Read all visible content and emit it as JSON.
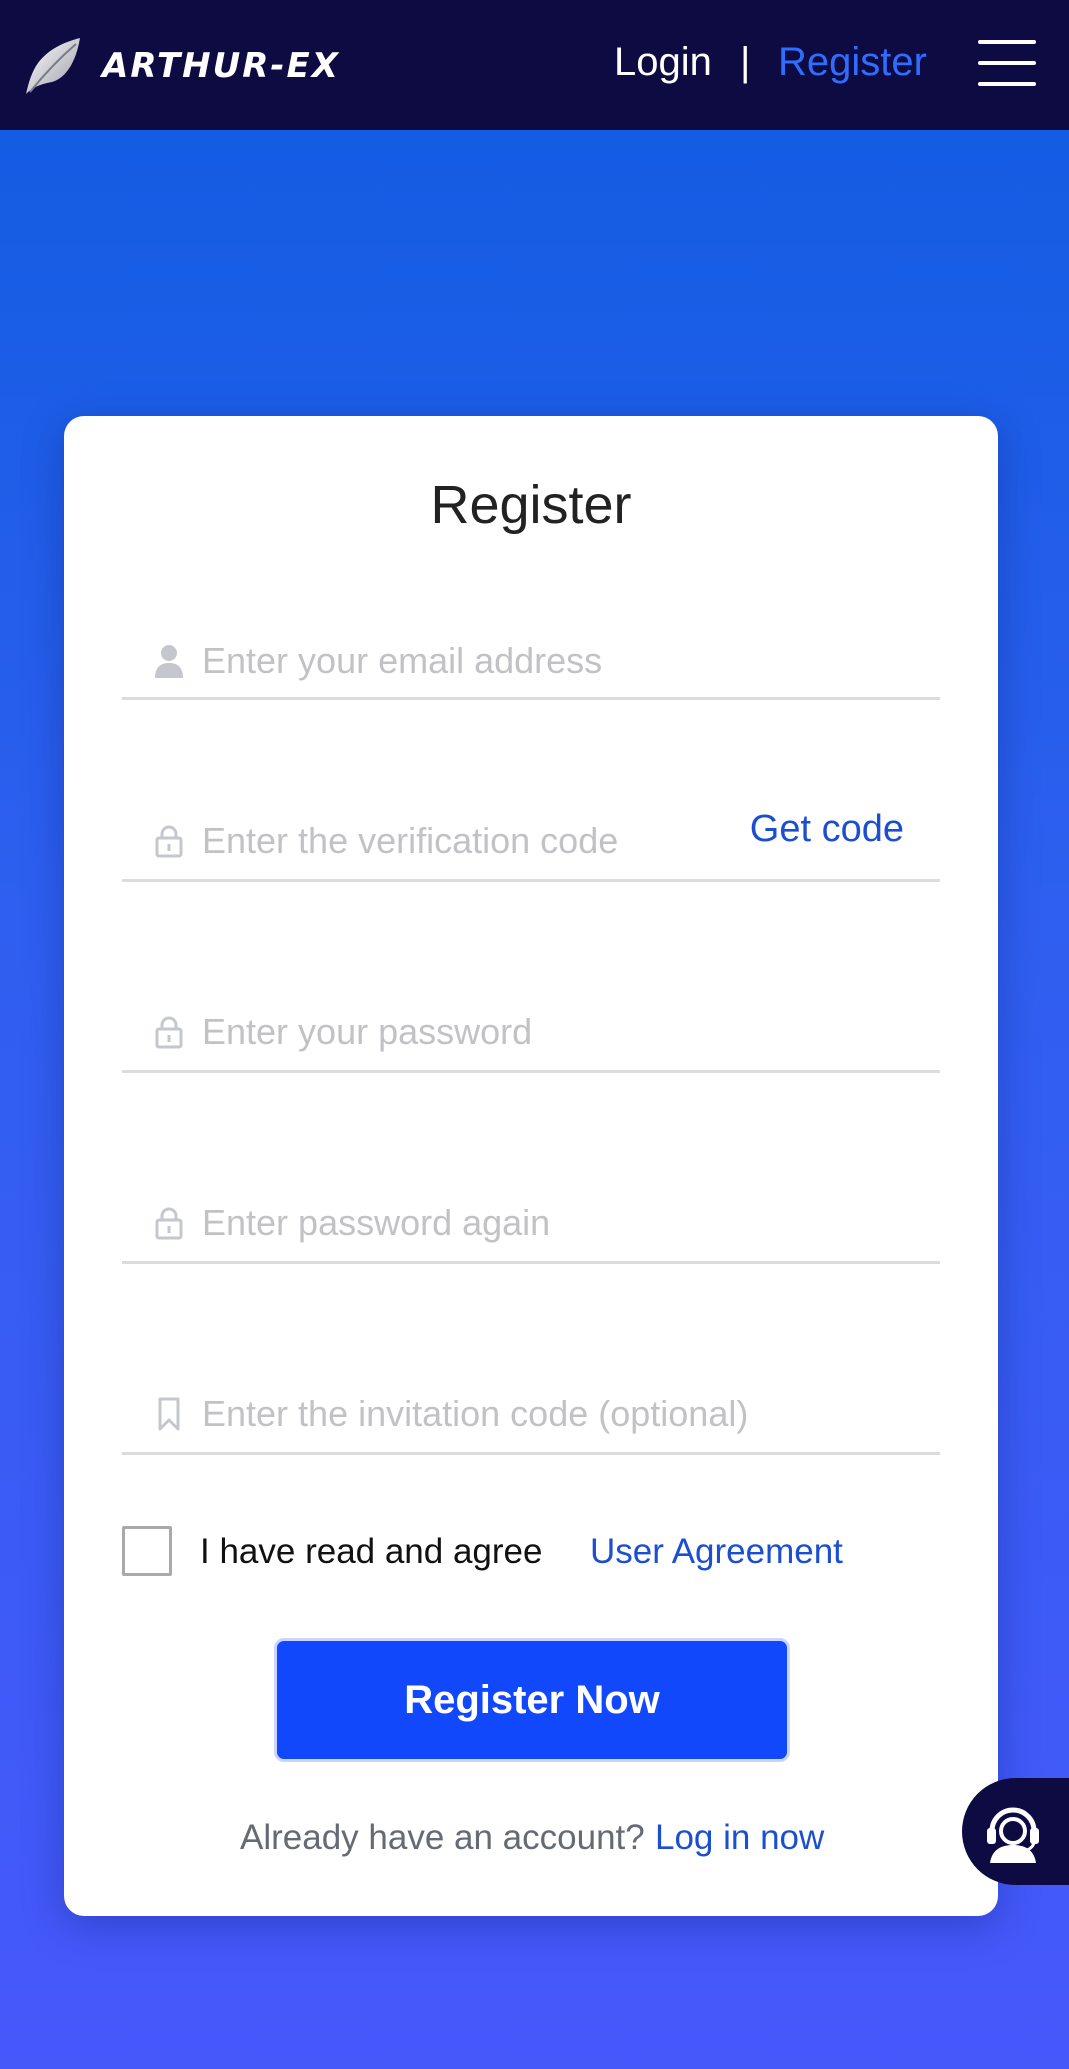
{
  "header": {
    "logo_text": "ARTHUR-EX",
    "login_label": "Login",
    "separator": "|",
    "register_label": "Register",
    "menu_icon": "hamburger-menu-icon"
  },
  "form": {
    "title": "Register",
    "email": {
      "placeholder": "Enter your email address",
      "value": "",
      "icon": "user-icon"
    },
    "verification": {
      "placeholder": "Enter the verification code",
      "value": "",
      "icon": "lock-icon",
      "action_label": "Get code"
    },
    "password": {
      "placeholder": "Enter your password",
      "value": "",
      "icon": "lock-icon"
    },
    "password_again": {
      "placeholder": "Enter password again",
      "value": "",
      "icon": "lock-icon"
    },
    "invitation": {
      "placeholder": "Enter the invitation code (optional)",
      "value": "",
      "icon": "bookmark-icon"
    },
    "agree_text": "I have read and agree",
    "agree_link": "User Agreement",
    "agree_checked": false,
    "submit_label": "Register Now",
    "login_prompt": "Already have an account?",
    "login_link": "Log in now"
  },
  "support": {
    "icon": "customer-support-icon"
  },
  "colors": {
    "header_bg": "#0e0a42",
    "accent": "#1148fb",
    "link": "#1c4fd0",
    "nav_active": "#2f6dff"
  }
}
